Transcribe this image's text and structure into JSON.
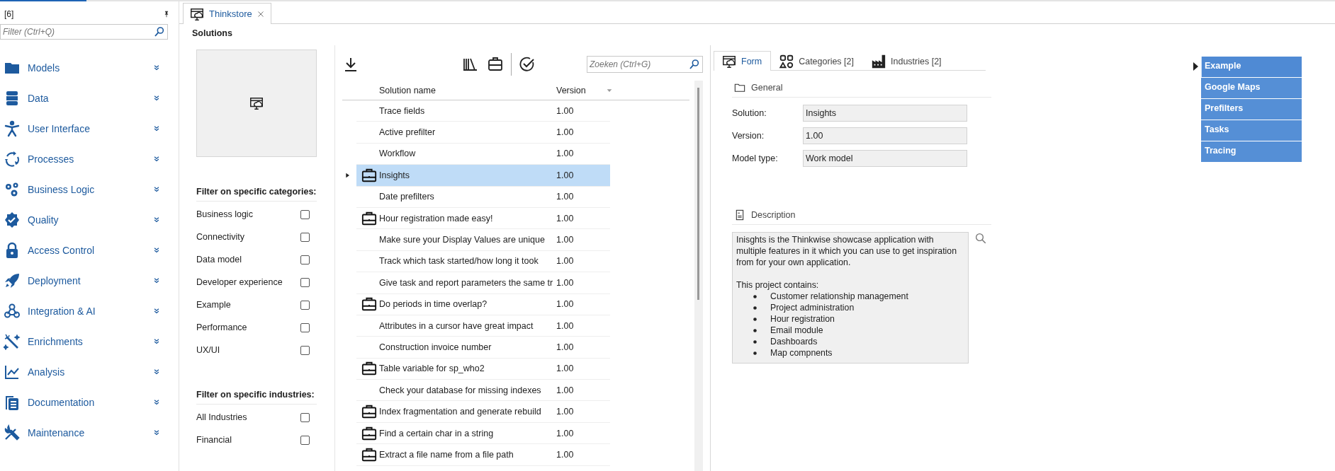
{
  "sidebar": {
    "title": "[6]",
    "filter": {
      "placeholder": "Filter (Ctrl+Q)"
    },
    "items": [
      {
        "label": "Models",
        "expanded": false
      },
      {
        "label": "Data",
        "expanded": false
      },
      {
        "label": "User Interface",
        "expanded": false
      },
      {
        "label": "Processes",
        "expanded": false
      },
      {
        "label": "Business Logic",
        "expanded": false
      },
      {
        "label": "Quality",
        "expanded": false
      },
      {
        "label": "Access Control",
        "expanded": false
      },
      {
        "label": "Deployment",
        "expanded": false
      },
      {
        "label": "Integration & AI",
        "expanded": false
      },
      {
        "label": "Enrichments",
        "expanded": false
      },
      {
        "label": "Analysis",
        "expanded": false
      },
      {
        "label": "Documentation",
        "expanded": false
      },
      {
        "label": "Maintenance",
        "expanded": false
      }
    ]
  },
  "document_tabs": [
    {
      "label": "Thinkstore",
      "selected": true
    }
  ],
  "page_title": "Solutions",
  "filters": [
    {
      "title": "Filter on specific categories:",
      "options": [
        {
          "label": "Business logic",
          "checked": false
        },
        {
          "label": "Connectivity",
          "checked": false
        },
        {
          "label": "Data model",
          "checked": false
        },
        {
          "label": "Developer experience",
          "checked": false
        },
        {
          "label": "Example",
          "checked": false
        },
        {
          "label": "Performance",
          "checked": false
        },
        {
          "label": "UX/UI",
          "checked": false
        }
      ]
    },
    {
      "title": "Filter on specific industries:",
      "options": [
        {
          "label": "All Industries",
          "checked": false
        },
        {
          "label": "Financial",
          "checked": false
        }
      ]
    }
  ],
  "grid": {
    "search": {
      "placeholder": "Zoeken (Ctrl+G)"
    },
    "columns": [
      "Solution name",
      "Version"
    ],
    "rows": [
      {
        "name": "Trace fields",
        "version": "1.00",
        "has_icon": false,
        "selected": false
      },
      {
        "name": "Active prefilter",
        "version": "1.00",
        "has_icon": false,
        "selected": false
      },
      {
        "name": "Workflow",
        "version": "1.00",
        "has_icon": false,
        "selected": false
      },
      {
        "name": "Insights",
        "version": "1.00",
        "has_icon": true,
        "selected": true
      },
      {
        "name": "Date prefilters",
        "version": "1.00",
        "has_icon": false,
        "selected": false
      },
      {
        "name": "Hour registration made easy!",
        "version": "1.00",
        "has_icon": true,
        "selected": false
      },
      {
        "name": "Make sure your Display Values are unique",
        "version": "1.00",
        "has_icon": false,
        "selected": false
      },
      {
        "name": "Track which task started/how long it took",
        "version": "1.00",
        "has_icon": false,
        "selected": false
      },
      {
        "name": "Give task and report parameters the same tr",
        "version": "1.00",
        "has_icon": false,
        "selected": false
      },
      {
        "name": "Do periods in time overlap?",
        "version": "1.00",
        "has_icon": true,
        "selected": false
      },
      {
        "name": "Attributes in a cursor have great impact",
        "version": "1.00",
        "has_icon": false,
        "selected": false
      },
      {
        "name": "Construction invoice number",
        "version": "1.00",
        "has_icon": false,
        "selected": false
      },
      {
        "name": "Table variable for sp_who2",
        "version": "1.00",
        "has_icon": true,
        "selected": false
      },
      {
        "name": "Check your database for missing indexes",
        "version": "1.00",
        "has_icon": false,
        "selected": false
      },
      {
        "name": "Index fragmentation and generate rebuild",
        "version": "1.00",
        "has_icon": true,
        "selected": false
      },
      {
        "name": "Find a certain char in a string",
        "version": "1.00",
        "has_icon": true,
        "selected": false
      },
      {
        "name": "Extract a file name from a file path",
        "version": "1.00",
        "has_icon": true,
        "selected": false
      }
    ]
  },
  "detail_tabs": [
    {
      "label": "Form",
      "selected": true
    },
    {
      "label": "Categories [2]",
      "selected": false
    },
    {
      "label": "Industries [2]",
      "selected": false
    }
  ],
  "general": {
    "title": "General",
    "fields": [
      {
        "label": "Solution:",
        "value": "Insights"
      },
      {
        "label": "Version:",
        "value": "1.00"
      },
      {
        "label": "Model type:",
        "value": "Work model"
      }
    ]
  },
  "description": {
    "title": "Description",
    "intro": "Inisghts is the Thinkwise showcase application with multiple features in it which you can use to get inspiration from for your own application.",
    "list_title": "This project contains:",
    "bullets": [
      "Customer relationship management",
      "Project administration",
      "Hour registration",
      "Email module",
      "Dashboards",
      "Map compnents"
    ]
  },
  "category_list": [
    {
      "label": "Example",
      "selected": true
    },
    {
      "label": "Google Maps",
      "selected": false
    },
    {
      "label": "Prefilters",
      "selected": false
    },
    {
      "label": "Tasks",
      "selected": false
    },
    {
      "label": "Tracing",
      "selected": false
    }
  ]
}
